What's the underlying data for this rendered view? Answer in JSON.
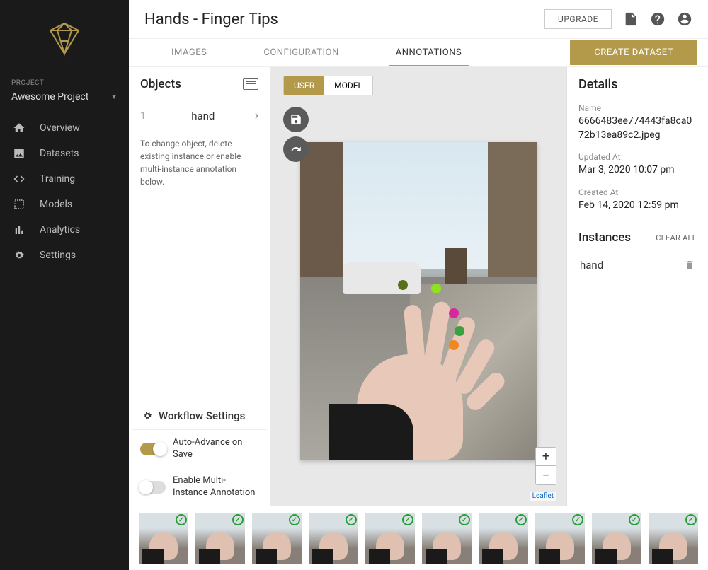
{
  "sidebar": {
    "project_label": "PROJECT",
    "project_name": "Awesome Project",
    "nav": [
      {
        "label": "Overview"
      },
      {
        "label": "Datasets"
      },
      {
        "label": "Training"
      },
      {
        "label": "Models"
      },
      {
        "label": "Analytics"
      },
      {
        "label": "Settings"
      }
    ]
  },
  "header": {
    "title": "Hands - Finger Tips",
    "upgrade": "UPGRADE"
  },
  "tabs": {
    "images": "IMAGES",
    "configuration": "CONFIGURATION",
    "annotations": "ANNOTATIONS",
    "create_dataset": "CREATE DATASET"
  },
  "objects": {
    "title": "Objects",
    "items": [
      {
        "index": "1",
        "name": "hand"
      }
    ],
    "hint": "To change object, delete existing instance or enable multi-instance annotation below."
  },
  "workflow": {
    "title": "Workflow Settings",
    "auto_advance": "Auto-Advance on Save",
    "multi_instance": "Enable Multi-Instance Annotation"
  },
  "mode": {
    "user": "USER",
    "model": "MODEL"
  },
  "zoom": {
    "in": "+",
    "out": "−"
  },
  "leaflet": "Leaflet",
  "details": {
    "title": "Details",
    "name_label": "Name",
    "name_value": "6666483ee774443fa8ca072b13ea89c2.jpeg",
    "updated_label": "Updated At",
    "updated_value": "Mar 3, 2020 10:07 pm",
    "created_label": "Created At",
    "created_value": "Feb 14, 2020 12:59 pm"
  },
  "instances": {
    "title": "Instances",
    "clear_all": "CLEAR ALL",
    "items": [
      {
        "name": "hand"
      }
    ]
  }
}
